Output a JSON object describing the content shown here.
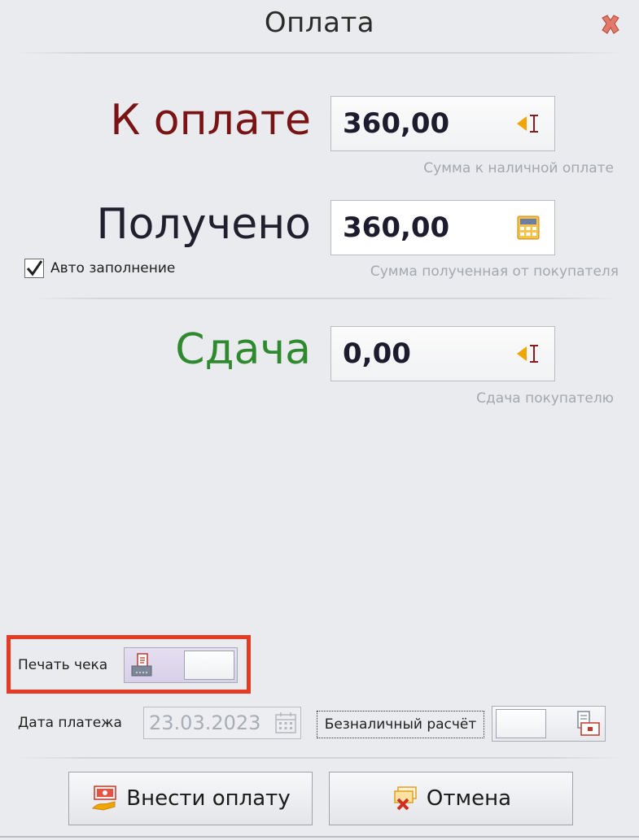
{
  "window": {
    "title": "Оплата"
  },
  "to_pay": {
    "label": "К оплате",
    "value": "360,00",
    "hint": "Сумма к наличной оплате",
    "label_color": "#7a1414"
  },
  "received": {
    "label": "Получено",
    "value": "360,00",
    "hint": "Сумма полученная от покупателя",
    "label_color": "#1f1f2e"
  },
  "auto_fill": {
    "label": "Авто заполнение",
    "checked": true
  },
  "change": {
    "label": "Сдача",
    "value": "0,00",
    "hint": "Сдача покупателю",
    "label_color": "#2f8a2f"
  },
  "print_receipt": {
    "label": "Печать чека",
    "enabled": false
  },
  "payment_date": {
    "label": "Дата платежа",
    "value": "23.03.2023"
  },
  "cashless": {
    "label": "Безналичный расчёт",
    "enabled": false
  },
  "buttons": {
    "submit_label": "Внести оплату",
    "cancel_label": "Отмена"
  },
  "colors": {
    "accent_red": "#e53a24",
    "icon_orange": "#f0a500"
  }
}
